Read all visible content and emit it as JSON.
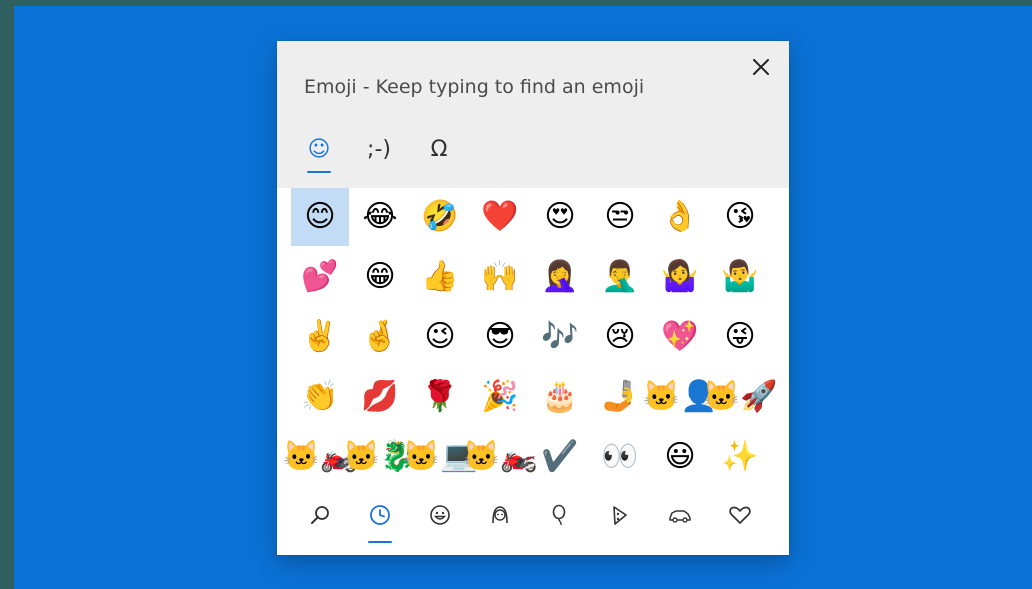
{
  "panel": {
    "title": "Emoji - Keep typing to find an emoji",
    "close_icon": "close-icon"
  },
  "mode_tabs": [
    {
      "id": "emoji",
      "glyph": "☺",
      "icon": "smiley-icon",
      "active": true
    },
    {
      "id": "kaomoji",
      "glyph": ";-)",
      "icon": "kaomoji-icon",
      "active": false
    },
    {
      "id": "symbols",
      "glyph": "Ω",
      "icon": "omega-icon",
      "active": false
    }
  ],
  "emoji_grid": [
    [
      "😊",
      "😂",
      "🤣",
      "❤️",
      "😍",
      "😒",
      "👌",
      "😘"
    ],
    [
      "💕",
      "😁",
      "👍",
      "🙌",
      "🤦‍♀️",
      "🤦‍♂️",
      "🤷‍♀️",
      "🤷‍♂️"
    ],
    [
      "✌️",
      "🤞",
      "😉",
      "😎",
      "🎶",
      "😢",
      "💖",
      "😜"
    ],
    [
      "👏",
      "💋",
      "🌹",
      "🎉",
      "🎂",
      "🤳",
      "🐱‍👤",
      "🐱‍🚀"
    ],
    [
      "🐱‍🏍",
      "🐱‍🐉",
      "🐱‍💻",
      "🐱‍🏍",
      "✔️",
      "👀",
      "😃",
      "✨"
    ]
  ],
  "selected_cell": {
    "row": 0,
    "col": 0
  },
  "category_tabs": [
    {
      "id": "search",
      "icon": "search-icon",
      "active": false
    },
    {
      "id": "recent",
      "icon": "clock-icon",
      "active": true
    },
    {
      "id": "smileys",
      "icon": "smiley-face-icon",
      "active": false
    },
    {
      "id": "people",
      "icon": "person-icon",
      "active": false
    },
    {
      "id": "celebrations",
      "icon": "balloon-icon",
      "active": false
    },
    {
      "id": "food",
      "icon": "pizza-icon",
      "active": false
    },
    {
      "id": "transport",
      "icon": "car-icon",
      "active": false
    },
    {
      "id": "symbols",
      "icon": "heart-icon",
      "active": false
    }
  ],
  "colors": {
    "desktop": "#0a72d6",
    "accent": "#1a73d8",
    "header_bg": "#eeeeee",
    "selected_bg": "#c3dcf5"
  }
}
